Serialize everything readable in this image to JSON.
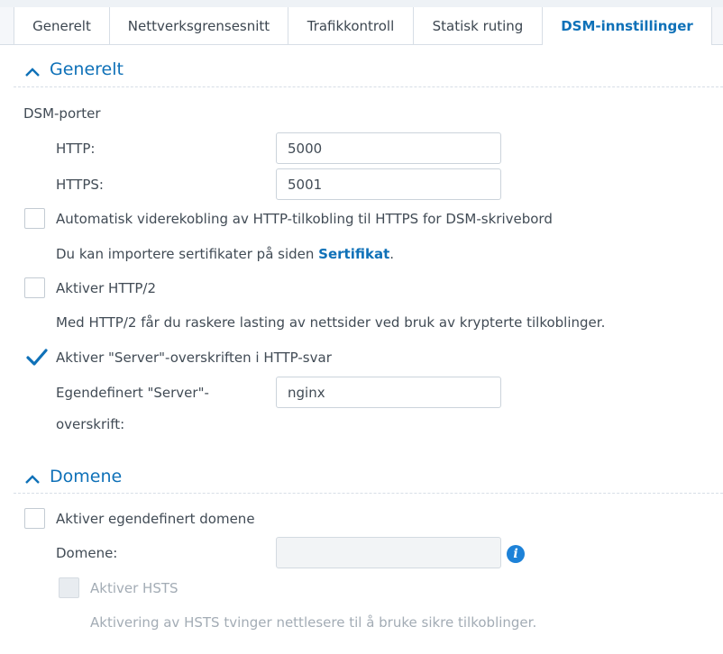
{
  "tabs": [
    {
      "label": "Generelt",
      "active": false
    },
    {
      "label": "Nettverksgrensesnitt",
      "active": false
    },
    {
      "label": "Trafikkontroll",
      "active": false
    },
    {
      "label": "Statisk ruting",
      "active": false
    },
    {
      "label": "DSM-innstillinger",
      "active": true
    }
  ],
  "general": {
    "title": "Generelt",
    "ports_label": "DSM-porter",
    "http_label": "HTTP:",
    "http_value": "5000",
    "https_label": "HTTPS:",
    "https_value": "5001",
    "redirect": {
      "label": "Automatisk viderekobling av HTTP-tilkobling til HTTPS for DSM-skrivebord",
      "checked": false
    },
    "cert_note_prefix": "Du kan importere sertifikater på siden ",
    "cert_link": "Sertifikat",
    "cert_note_suffix": ".",
    "http2": {
      "label": "Aktiver HTTP/2",
      "checked": false
    },
    "http2_note": "Med HTTP/2 får du raskere lasting av nettsider ved bruk av krypterte tilkoblinger.",
    "server_header": {
      "label": "Aktiver \"Server\"-overskriften i HTTP-svar",
      "checked": true
    },
    "custom_server_label_line1": "Egendefinert \"Server\"-",
    "custom_server_label_line2": "overskrift:",
    "custom_server_value": "nginx"
  },
  "domain": {
    "title": "Domene",
    "custom_domain": {
      "label": "Aktiver egendefinert domene",
      "checked": false
    },
    "domain_label": "Domene:",
    "domain_value": "",
    "info_glyph": "i",
    "hsts": {
      "label": "Aktiver HSTS",
      "checked": false,
      "disabled": true
    },
    "hsts_note": "Aktivering av HSTS tvinger nettlesere til å bruke sikre tilkoblinger."
  },
  "icons": {
    "section_toggle": "chevron-up-icon",
    "check": "checkmark-icon",
    "info": "info-icon"
  },
  "colors": {
    "accent": "#0f71b8",
    "text": "#414b55",
    "muted": "#a3acb5",
    "info": "#1d82d8"
  }
}
